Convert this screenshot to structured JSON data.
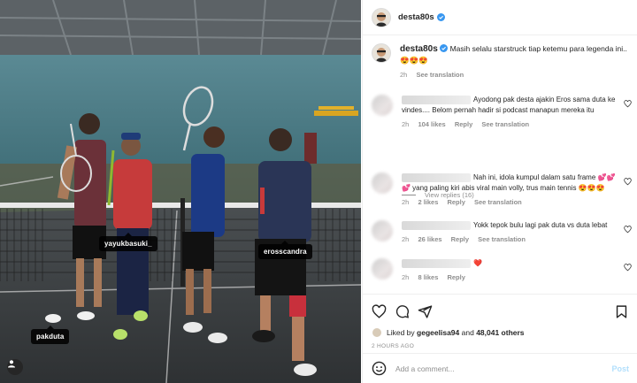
{
  "post": {
    "username": "desta80s",
    "caption": "Masih selalu starstruck tiap ketemu para legenda ini..",
    "caption_emojis": "😍😍😍",
    "caption_time": "2h",
    "see_translation": "See translation"
  },
  "photo": {
    "tags": [
      "yayukbasuki_",
      "erosscandra",
      "pakduta"
    ]
  },
  "comments": [
    {
      "text": "Ayodong pak desta ajakin Eros sama duta ke vindes.... Belom pernah hadir si podcast manapun mereka itu",
      "time": "2h",
      "likes": "104 likes",
      "reply": "Reply",
      "translate": "See translation"
    },
    {
      "text": "Nah ini, idola kumpul dalam satu frame 💕💕💕 yang paling kiri abis viral main volly, trus main tennis 😍😍😍",
      "time": "2h",
      "likes": "2 likes",
      "reply": "Reply",
      "translate": "See translation"
    },
    {
      "text": "Yokk tepok bulu lagi pak duta vs duta lebat",
      "time": "2h",
      "likes": "26 likes",
      "reply": "Reply",
      "translate": "See translation"
    },
    {
      "text": "❤️",
      "time": "2h",
      "likes": "8 likes",
      "reply": "Reply"
    }
  ],
  "view_replies": "View replies (16)",
  "likes_line": {
    "prefix": "Liked by",
    "user": "gegeelisa94",
    "mid": "and",
    "count": "48,041 others"
  },
  "time_ago": "2 HOURS AGO",
  "add_comment": {
    "placeholder": "Add a comment...",
    "post_label": "Post"
  },
  "colors": {
    "link_blue": "#0095f6",
    "verified_blue": "#3897f0",
    "heart_red": "#ed4956"
  }
}
